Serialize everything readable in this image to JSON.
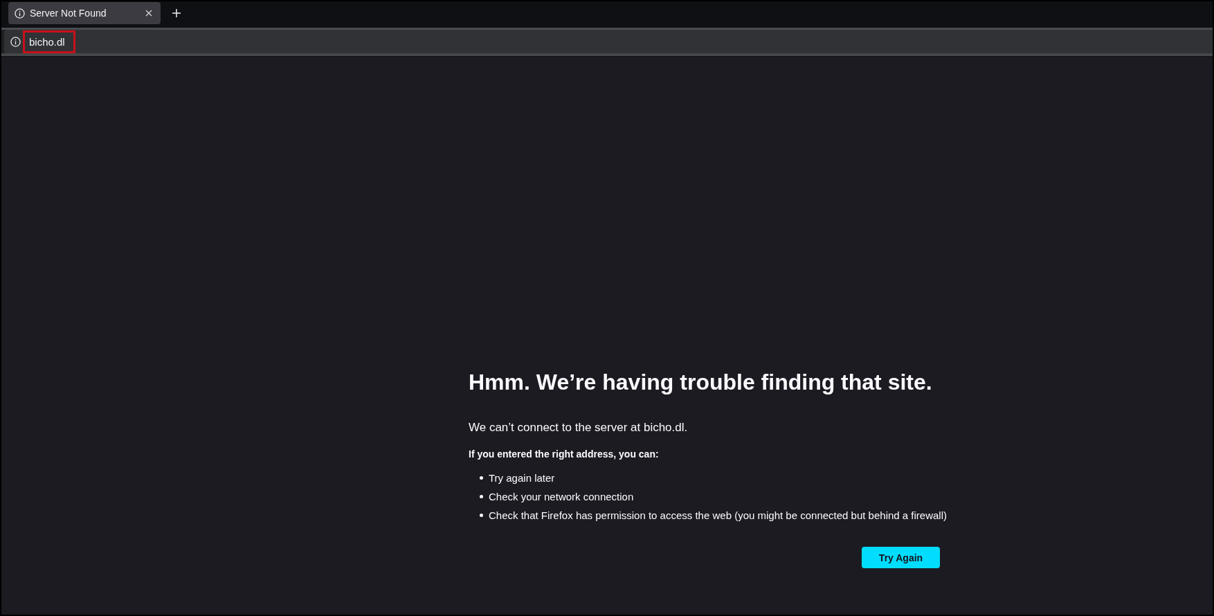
{
  "window": {
    "tabs": [
      {
        "title": "Server Not Found",
        "selected": true
      }
    ]
  },
  "address_bar": {
    "url": "bicho.dl",
    "highlighted": true
  },
  "error_page": {
    "title": "Hmm. We’re having trouble finding that site.",
    "description": "We can’t connect to the server at bicho.dl.",
    "suggestions_heading": "If you entered the right address, you can:",
    "suggestions": [
      "Try again later",
      "Check your network connection",
      "Check that Firefox has permission to access the web (you might be connected but behind a firewall)"
    ],
    "button": "Try Again"
  }
}
